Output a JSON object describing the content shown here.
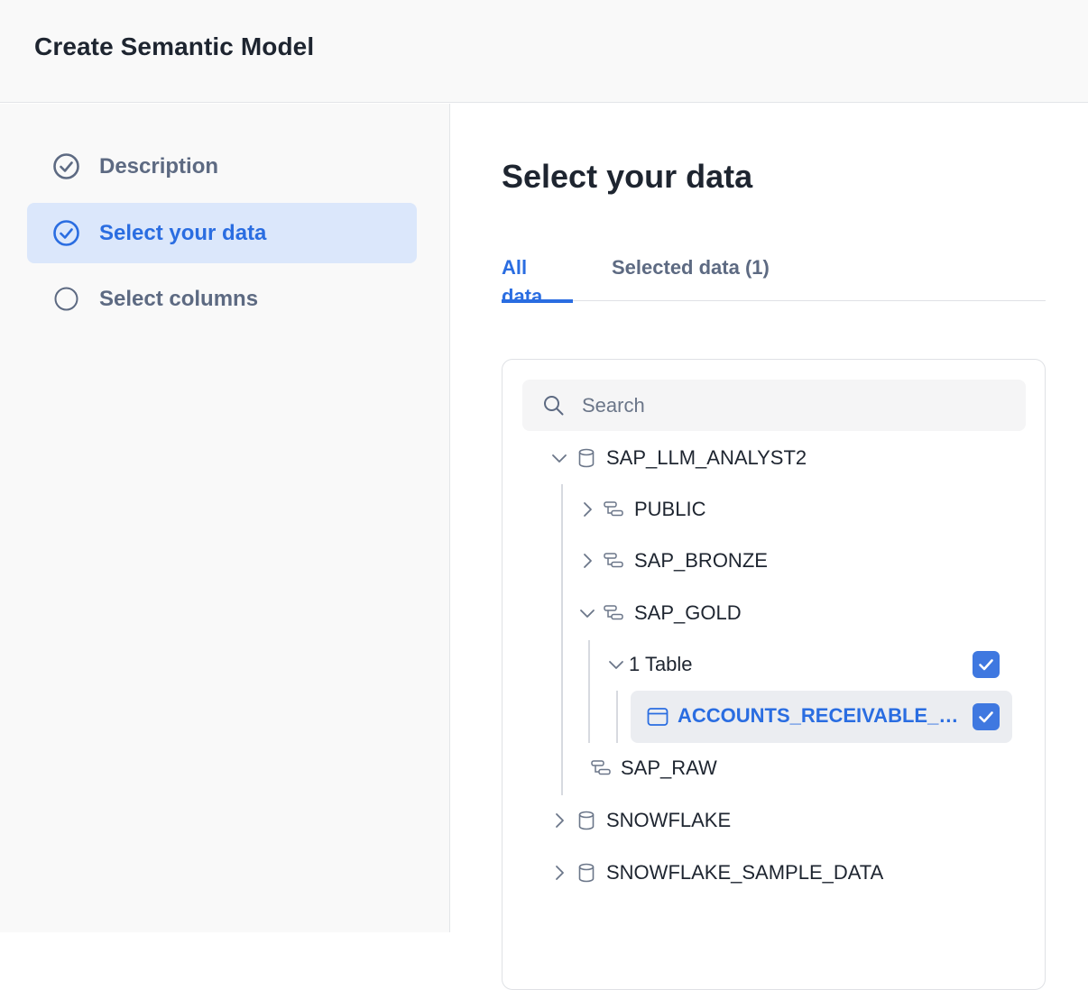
{
  "header": {
    "title": "Create Semantic Model"
  },
  "sidebar": {
    "steps": [
      {
        "label": "Description",
        "state": "done"
      },
      {
        "label": "Select your data",
        "state": "active"
      },
      {
        "label": "Select columns",
        "state": "pending"
      }
    ]
  },
  "main": {
    "title": "Select your data",
    "tabs": [
      {
        "label": "All data",
        "active": true
      },
      {
        "label": "Selected data (1)",
        "active": false
      }
    ],
    "search": {
      "placeholder": "Search",
      "value": ""
    },
    "tree": {
      "db1": "SAP_LLM_ANALYST2",
      "schema_public": "PUBLIC",
      "schema_bronze": "SAP_BRONZE",
      "schema_gold": "SAP_GOLD",
      "tables_group": "1 Table",
      "table": "ACCOUNTS_RECEIVABLE_M...",
      "schema_raw": "SAP_RAW",
      "db2": "SNOWFLAKE",
      "db3": "SNOWFLAKE_SAMPLE_DATA"
    }
  },
  "colors": {
    "accent": "#2a6de1",
    "checkbox": "#3f78e0",
    "active_step_bg": "#dbe7fb"
  }
}
